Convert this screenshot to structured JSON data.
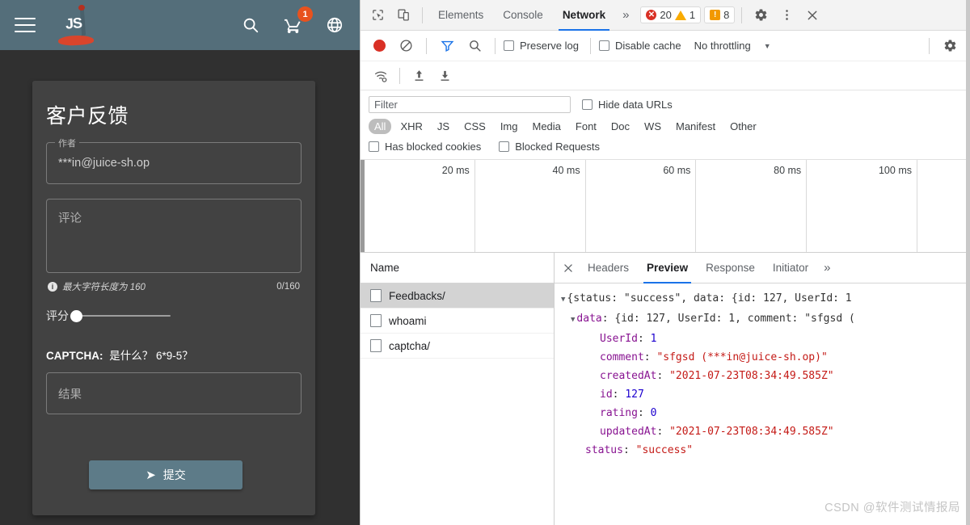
{
  "app": {
    "toolbar": {
      "menu_icon": "hamburger-menu-icon",
      "logo_text": "JS",
      "search_icon": "search-icon",
      "cart_icon": "shopping-cart-icon",
      "cart_badge": "1",
      "language_icon": "globe-language-icon"
    },
    "feedback": {
      "title": "客户反馈",
      "author_label": "作者",
      "author_value": "***in@juice-sh.op",
      "comment_placeholder": "评论",
      "hint_icon": "info-icon",
      "hint_text": "最大字符长度为 160",
      "char_counter": "0/160",
      "rating_label": "评分",
      "rating_value": 0,
      "captcha_label": "CAPTCHA:",
      "captcha_question": "是什么？   6*9-5？",
      "captcha_placeholder": "结果",
      "submit_icon": "send-icon",
      "submit_label": "提交"
    }
  },
  "devtools": {
    "tabbar": {
      "inspect_icon": "inspect-element-icon",
      "device_icon": "device-toolbar-icon",
      "tabs": [
        {
          "label": "Elements",
          "active": false
        },
        {
          "label": "Console",
          "active": false
        },
        {
          "label": "Network",
          "active": true
        }
      ],
      "more_tabs_icon": "chevron-double-right-icon",
      "error_count": "20",
      "warning_count": "1",
      "issue_count": "8",
      "settings_icon": "gear-icon",
      "kebab_icon": "more-vertical-icon",
      "close_icon": "close-icon"
    },
    "network_toolbar": {
      "record_icon": "record-button-icon",
      "clear_icon": "clear-network-log-icon",
      "filter_icon": "filter-funnel-icon",
      "search_icon": "search-icon",
      "preserve_log": "Preserve log",
      "disable_cache": "Disable cache",
      "throttling": "No throttling",
      "throttle_caret": "chevron-down-icon",
      "settings_icon": "gear-icon",
      "wifi_icon": "network-conditions-icon",
      "import_icon": "import-har-icon",
      "export_icon": "export-har-icon"
    },
    "filter_bar": {
      "filter_placeholder": "Filter",
      "hide_data_urls": "Hide data URLs",
      "types": [
        "All",
        "XHR",
        "JS",
        "CSS",
        "Img",
        "Media",
        "Font",
        "Doc",
        "WS",
        "Manifest",
        "Other"
      ],
      "active_type": "All",
      "has_blocked_cookies": "Has blocked cookies",
      "blocked_requests": "Blocked Requests"
    },
    "overview_ticks": [
      "20 ms",
      "40 ms",
      "60 ms",
      "80 ms",
      "100 ms"
    ],
    "request_list": {
      "column_header": "Name",
      "rows": [
        {
          "name": "Feedbacks/",
          "selected": true
        },
        {
          "name": "whoami",
          "selected": false
        },
        {
          "name": "captcha/",
          "selected": false
        }
      ]
    },
    "detail": {
      "close_icon": "close-icon",
      "tabs": [
        {
          "label": "Headers",
          "active": false
        },
        {
          "label": "Preview",
          "active": true
        },
        {
          "label": "Response",
          "active": false
        },
        {
          "label": "Initiator",
          "active": false
        }
      ],
      "more_icon": "chevron-double-right-icon",
      "preview": {
        "line0": "{status: \"success\", data: {id: 127, UserId: 1",
        "line1": "data: {id: 127, UserId: 1, comment: \"sfgsd (",
        "rows": [
          {
            "key": "UserId",
            "value": "1",
            "type": "num"
          },
          {
            "key": "comment",
            "value": "\"sfgsd (***in@juice-sh.op)\"",
            "type": "str"
          },
          {
            "key": "createdAt",
            "value": "\"2021-07-23T08:34:49.585Z\"",
            "type": "str"
          },
          {
            "key": "id",
            "value": "127",
            "type": "num"
          },
          {
            "key": "rating",
            "value": "0",
            "type": "num"
          },
          {
            "key": "updatedAt",
            "value": "\"2021-07-23T08:34:49.585Z\"",
            "type": "str"
          }
        ],
        "status_key": "status",
        "status_value": "\"success\""
      }
    }
  },
  "watermark": "CSDN @软件测试情报局",
  "colors": {
    "app_toolbar": "#546e7a",
    "app_bg": "#303030",
    "card_bg": "#424242",
    "submit_btn": "#5d7b88",
    "cart_badge": "#e8521e",
    "devtools_accent": "#1a73e8",
    "error_red": "#d93025",
    "warn_yellow": "#f9ab00",
    "issue_orange": "#f29900"
  }
}
